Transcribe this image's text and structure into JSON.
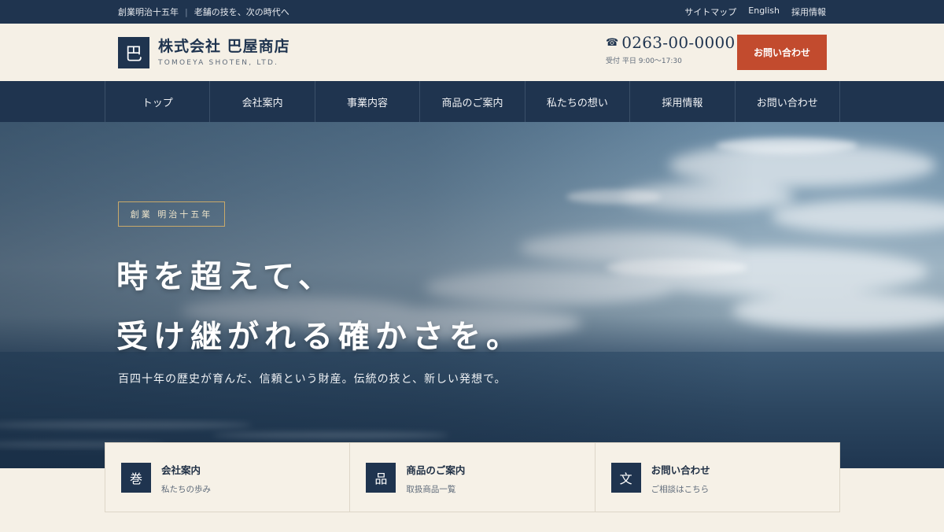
{
  "topbar": {
    "tagline_left": "創業明治十五年",
    "tagline_right": "老舗の技を、次の時代へ",
    "links": [
      "サイトマップ",
      "English",
      "採用情報"
    ]
  },
  "header": {
    "logo_char": "巴",
    "company_name": "株式会社 巴屋商店",
    "company_name_en": "TOMOEYA SHOTEN, LTD.",
    "phone_icon": "☎",
    "phone_number": "0263-00-0000",
    "phone_hours": "受付 平日 9:00〜17:30",
    "contact_button": "お問い合わせ"
  },
  "nav": {
    "items": [
      "トップ",
      "会社案内",
      "事業内容",
      "商品のご案内",
      "私たちの想い",
      "採用情報",
      "お問い合わせ"
    ]
  },
  "hero": {
    "badge": "創業 明治十五年",
    "headline_line1": "時を超えて、",
    "headline_line2": "受け継がれる確かさを。",
    "subheadline": "百四十年の歴史が育んだ、信頼という財産。伝統の技と、新しい発想で。"
  },
  "cards": [
    {
      "icon_char": "巻",
      "icon_name": "scroll-icon",
      "title": "会社案内",
      "desc": "私たちの歩み"
    },
    {
      "icon_char": "品",
      "icon_name": "goods-icon",
      "title": "商品のご案内",
      "desc": "取扱商品一覧"
    },
    {
      "icon_char": "文",
      "icon_name": "letter-icon",
      "title": "お問い合わせ",
      "desc": "ご相談はこちら"
    }
  ],
  "colors": {
    "navy": "#1f344f",
    "accent": "#c24b2e",
    "cream": "#f5f0e6",
    "gold": "#c9a96a"
  }
}
